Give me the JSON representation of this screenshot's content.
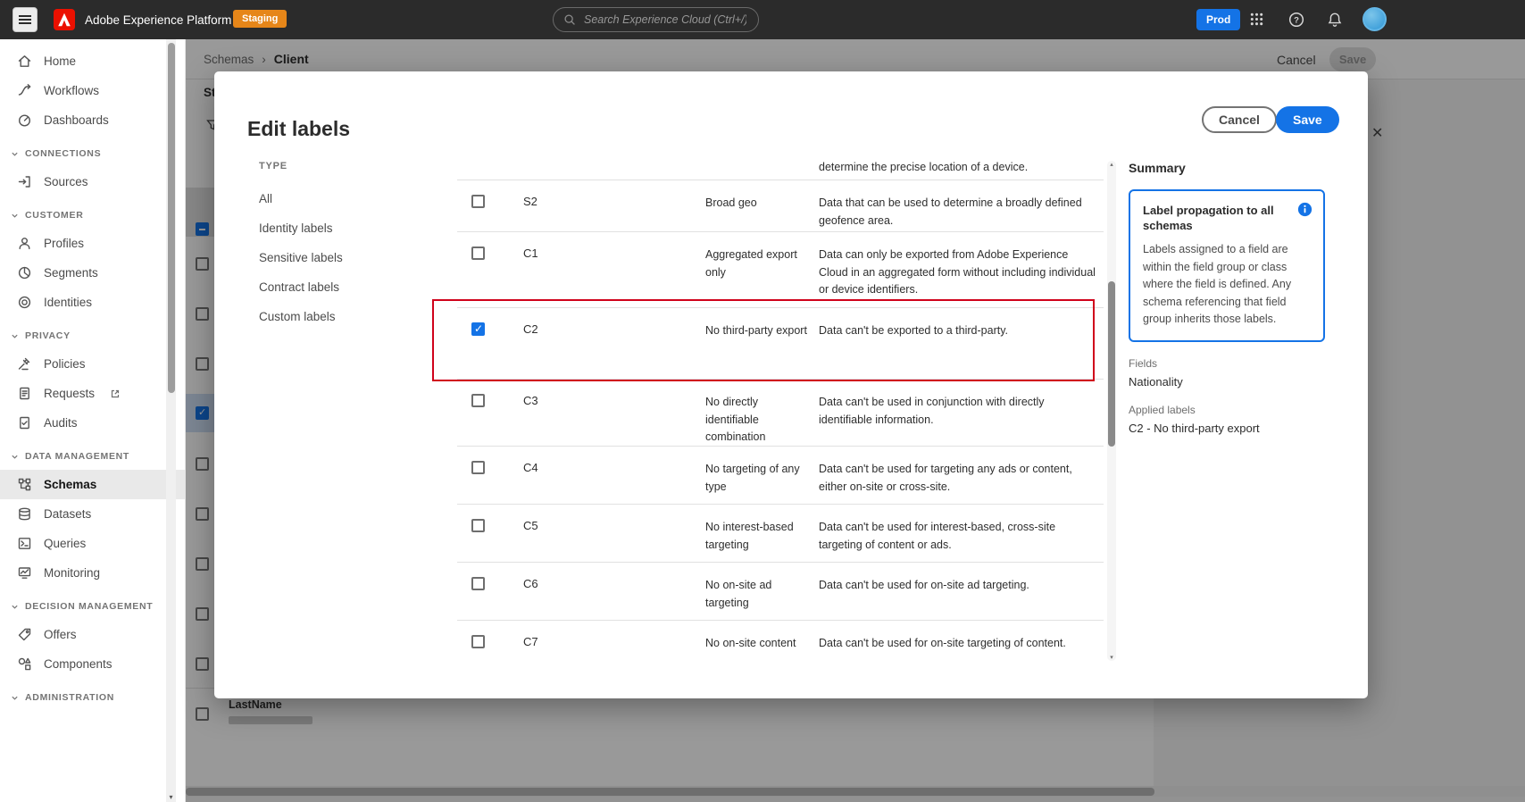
{
  "topbar": {
    "product_name": "Adobe Experience Platform",
    "environment_badge": "Staging",
    "search_placeholder": "Search Experience Cloud (Ctrl+/)",
    "prod_button": "Prod"
  },
  "sidebar": {
    "primary": [
      {
        "icon": "home-icon",
        "label": "Home"
      },
      {
        "icon": "workflows-icon",
        "label": "Workflows"
      },
      {
        "icon": "dashboards-icon",
        "label": "Dashboards"
      }
    ],
    "sections": [
      {
        "title": "CONNECTIONS",
        "items": [
          {
            "icon": "sources-icon",
            "label": "Sources"
          }
        ]
      },
      {
        "title": "CUSTOMER",
        "items": [
          {
            "icon": "profiles-icon",
            "label": "Profiles"
          },
          {
            "icon": "segments-icon",
            "label": "Segments"
          },
          {
            "icon": "identities-icon",
            "label": "Identities"
          }
        ]
      },
      {
        "title": "PRIVACY",
        "items": [
          {
            "icon": "policies-icon",
            "label": "Policies"
          },
          {
            "icon": "requests-icon",
            "label": "Requests",
            "external_link": true
          },
          {
            "icon": "audits-icon",
            "label": "Audits"
          }
        ]
      },
      {
        "title": "DATA MANAGEMENT",
        "items": [
          {
            "icon": "schemas-icon",
            "label": "Schemas",
            "selected": true
          },
          {
            "icon": "datasets-icon",
            "label": "Datasets"
          },
          {
            "icon": "queries-icon",
            "label": "Queries"
          },
          {
            "icon": "monitoring-icon",
            "label": "Monitoring"
          }
        ]
      },
      {
        "title": "DECISION MANAGEMENT",
        "items": [
          {
            "icon": "offers-icon",
            "label": "Offers"
          },
          {
            "icon": "components-icon",
            "label": "Components"
          }
        ]
      },
      {
        "title": "ADMINISTRATION",
        "items": []
      }
    ]
  },
  "background_page": {
    "breadcrumb": {
      "parent": "Schemas",
      "separator": "›",
      "current": "Client"
    },
    "cancel_button": "Cancel",
    "save_button": "Save",
    "partial_tab_label": "Str",
    "field_row_label": "LastName"
  },
  "modal": {
    "title": "Edit labels",
    "cancel_button": "Cancel",
    "save_button": "Save",
    "filter": {
      "heading": "TYPE",
      "options": [
        {
          "label": "All"
        },
        {
          "label": "Identity labels"
        },
        {
          "label": "Sensitive labels"
        },
        {
          "label": "Contract labels"
        },
        {
          "label": "Custom labels"
        }
      ]
    },
    "labels_table": {
      "clipped_text_top": "determine the precise location of a device.",
      "rows": [
        {
          "checked": false,
          "code": "S2",
          "name": "Broad geo",
          "description": "Data that can be used to determine a broadly defined geofence area."
        },
        {
          "checked": false,
          "code": "C1",
          "name": "Aggregated export only",
          "description": "Data can only be exported from Adobe Experience Cloud in an aggregated form without including individual or device identifiers."
        },
        {
          "checked": true,
          "code": "C2",
          "name": "No third-party export",
          "description": "Data can't be exported to a third-party.",
          "annotated": true
        },
        {
          "checked": false,
          "code": "C3",
          "name": "No directly identifiable combination",
          "description": "Data can't be used in conjunction with directly identifiable information."
        },
        {
          "checked": false,
          "code": "C4",
          "name": "No targeting of any type",
          "description": "Data can't be used for targeting any ads or content, either on-site or cross-site."
        },
        {
          "checked": false,
          "code": "C5",
          "name": "No interest-based targeting",
          "description": "Data can't be used for interest-based, cross-site targeting of content or ads."
        },
        {
          "checked": false,
          "code": "C6",
          "name": "No on-site ad targeting",
          "description": "Data can't be used for on-site ad targeting."
        },
        {
          "checked": false,
          "code": "C7",
          "name": "No on-site content",
          "description": "Data can't be used for on-site targeting of content."
        }
      ]
    },
    "summary": {
      "heading": "Summary",
      "propagation_card": {
        "title": "Label propagation to all schemas",
        "body": "Labels assigned to a field are within the field group or class where the field is defined. Any schema referencing that field group inherits those labels."
      },
      "fields_heading": "Fields",
      "fields_value": "Nationality",
      "applied_heading": "Applied labels",
      "applied_value": "C2 - No third-party export"
    }
  },
  "annotation": {
    "shape": "rectangle",
    "color": "#d0021b"
  },
  "colors": {
    "accent_blue": "#1473e6",
    "staging_orange": "#e68619",
    "adobe_red": "#eb1000",
    "annotation_red": "#d0021b",
    "topbar_bg": "#2b2b2b"
  }
}
